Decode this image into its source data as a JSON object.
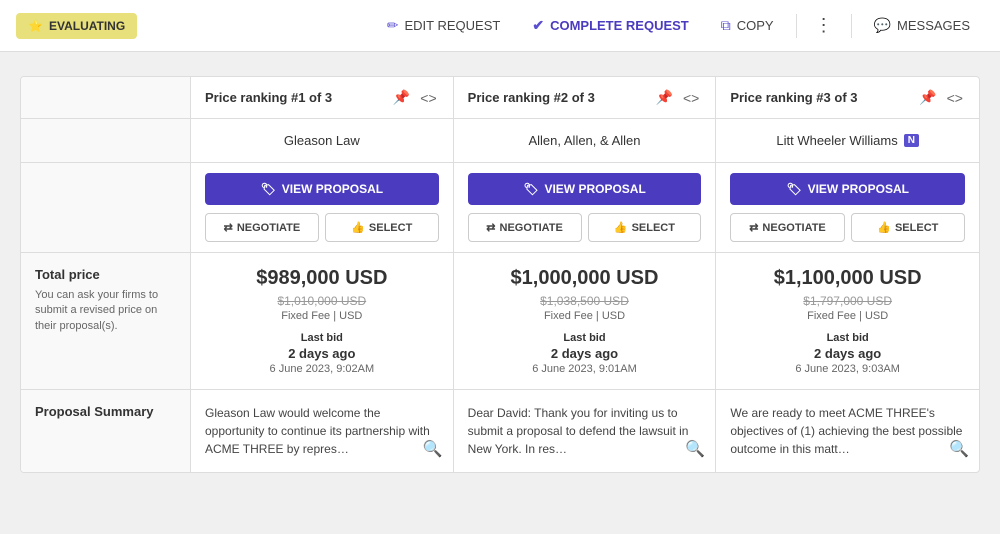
{
  "toolbar": {
    "badge": {
      "icon": "⭐",
      "label": "EVALUATING"
    },
    "buttons": [
      {
        "id": "edit-request",
        "icon": "✏️",
        "label": "EDIT REQUEST"
      },
      {
        "id": "complete-request",
        "icon": "✔",
        "label": "COMPLETE REQUEST",
        "purple": true
      },
      {
        "id": "copy",
        "icon": "⧉",
        "label": "COPY"
      },
      {
        "id": "more",
        "icon": "⋮",
        "label": ""
      },
      {
        "id": "messages",
        "icon": "💬",
        "label": "MESSAGES"
      }
    ]
  },
  "rankings": [
    {
      "id": 1,
      "header": "Price ranking #1 of 3",
      "firm": "Gleason Law",
      "firm_badge": null,
      "view_proposal_label": "VIEW PROPOSAL",
      "negotiate_label": "NEGOTIATE",
      "select_label": "SELECT",
      "price_main": "$989,000 USD",
      "price_original": "$1,010,000 USD",
      "price_type": "Fixed Fee | USD",
      "last_bid_label": "Last bid",
      "last_bid_days": "2 days ago",
      "last_bid_date": "6 June 2023, 9:02AM",
      "summary": "Gleason Law would welcome the opportunity to continue its partnership with ACME THREE by repres…"
    },
    {
      "id": 2,
      "header": "Price ranking #2 of 3",
      "firm": "Allen, Allen, & Allen",
      "firm_badge": null,
      "view_proposal_label": "VIEW PROPOSAL",
      "negotiate_label": "NEGOTIATE",
      "select_label": "SELECT",
      "price_main": "$1,000,000 USD",
      "price_original": "$1,038,500 USD",
      "price_type": "Fixed Fee | USD",
      "last_bid_label": "Last bid",
      "last_bid_days": "2 days ago",
      "last_bid_date": "6 June 2023, 9:01AM",
      "summary": "Dear David: Thank you for inviting us to submit a proposal to defend the lawsuit in New York. In res…"
    },
    {
      "id": 3,
      "header": "Price ranking #3 of 3",
      "firm": "Litt Wheeler Williams",
      "firm_badge": "N",
      "view_proposal_label": "VIEW PROPOSAL",
      "negotiate_label": "NEGOTIATE",
      "select_label": "SELECT",
      "price_main": "$1,100,000 USD",
      "price_original": "$1,797,000 USD",
      "price_type": "Fixed Fee | USD",
      "last_bid_label": "Last bid",
      "last_bid_days": "2 days ago",
      "last_bid_date": "6 June 2023, 9:03AM",
      "summary": "We are ready to meet ACME THREE's objectives of (1) achieving the best possible outcome in this matt…"
    }
  ],
  "labels": {
    "total_price": "Total price",
    "total_price_desc": "You can ask your firms to submit a revised price on their proposal(s).",
    "proposal_summary": "Proposal Summary"
  }
}
